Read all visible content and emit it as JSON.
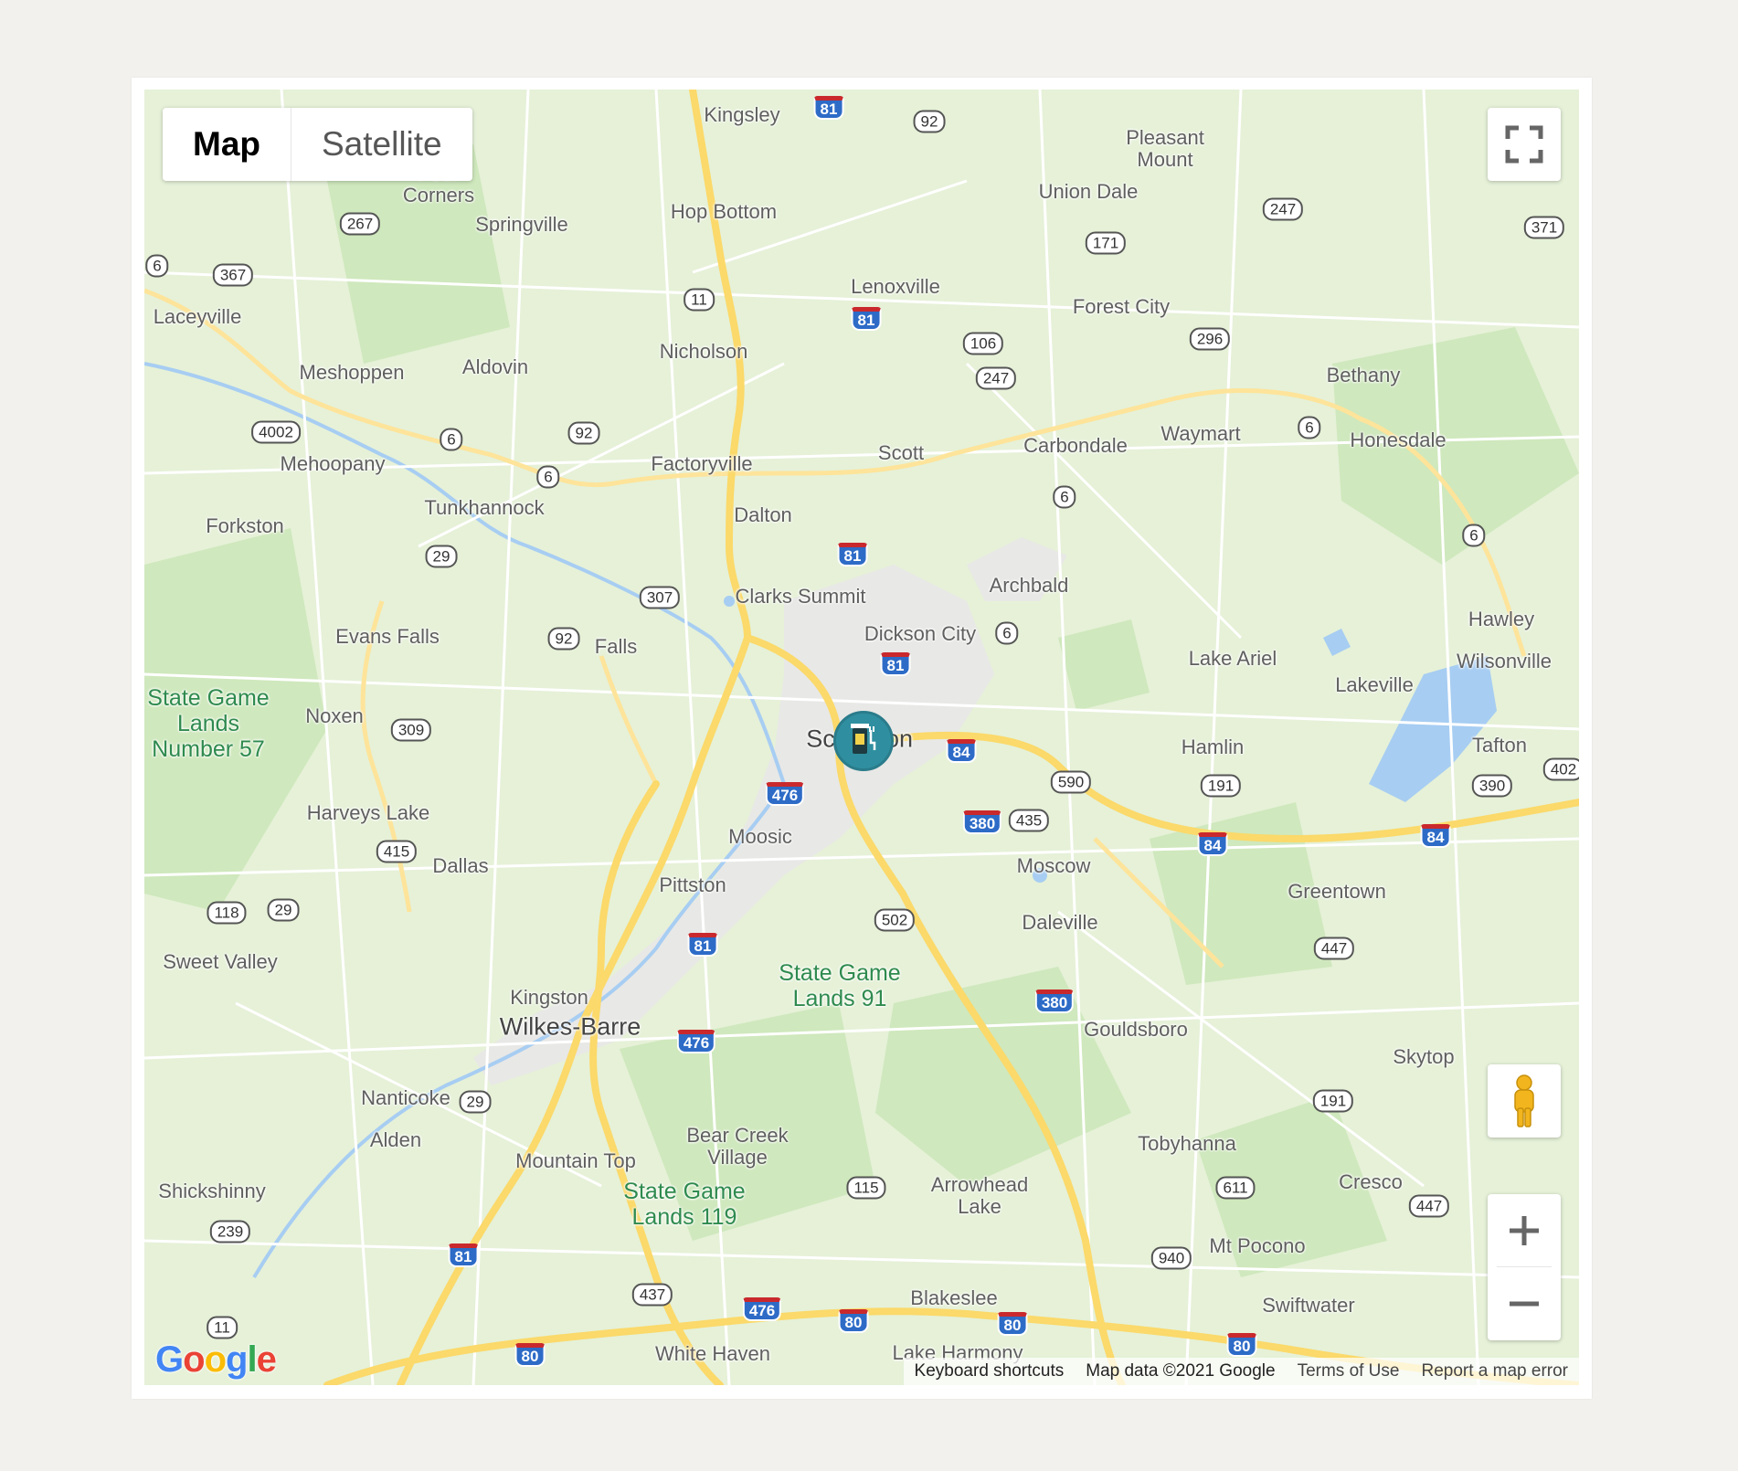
{
  "map_type_control": {
    "map_label": "Map",
    "satellite_label": "Satellite",
    "selected": "Map"
  },
  "controls": {
    "fullscreen_icon": "fullscreen-icon",
    "street_view_icon": "pegman-icon",
    "zoom_in_icon": "plus-icon",
    "zoom_out_icon": "minus-icon"
  },
  "marker": {
    "icon": "ev-charging-station-icon",
    "color": "#2f8fa0"
  },
  "footer": {
    "logo": "Google",
    "keyboard_shortcuts": "Keyboard shortcuts",
    "map_data": "Map data ©2021 Google",
    "terms": "Terms of Use",
    "report": "Report a map error"
  },
  "places": {
    "kingsley": "Kingsley",
    "pleasant_mount": "Pleasant\nMount",
    "union_dale": "Union Dale",
    "four_corners": "Four\nCorners",
    "springville": "Springville",
    "hop_bottom": "Hop Bottom",
    "laceyville": "Laceyville",
    "lenoxville": "Lenoxville",
    "forest_city": "Forest City",
    "meshoppen": "Meshoppen",
    "aldovin": "Aldovin",
    "nicholson": "Nicholson",
    "bethany": "Bethany",
    "mehoopany": "Mehoopany",
    "factoryville": "Factoryville",
    "scott": "Scott",
    "carbondale": "Carbondale",
    "waymart": "Waymart",
    "honesdale": "Honesdale",
    "forkston": "Forkston",
    "tunkhannock": "Tunkhannock",
    "dalton": "Dalton",
    "archbald": "Archbald",
    "clarks_summit": "Clarks Summit",
    "hawley": "Hawley",
    "evans_falls": "Evans Falls",
    "falls": "Falls",
    "dickson_city": "Dickson City",
    "lake_ariel": "Lake Ariel",
    "wilsonville": "Wilsonville",
    "lakeville": "Lakeville",
    "noxen": "Noxen",
    "scranton_left": "Sc",
    "scranton_right": "on",
    "hamlin": "Hamlin",
    "tafton": "Tafton",
    "harveys_lake": "Harveys Lake",
    "moosic": "Moosic",
    "moscow": "Moscow",
    "dallas": "Dallas",
    "pittston": "Pittston",
    "greentown": "Greentown",
    "daleville": "Daleville",
    "sweet_valley": "Sweet Valley",
    "kingston": "Kingston",
    "wilkes_barre": "Wilkes-Barre",
    "gouldsboro": "Gouldsboro",
    "skytop": "Skytop",
    "nanticoke": "Nanticoke",
    "alden": "Alden",
    "bear_creek": "Bear Creek\nVillage",
    "tobyhanna": "Tobyhanna",
    "mountain_top": "Mountain Top",
    "arrowhead_lake": "Arrowhead\nLake",
    "cresco": "Cresco",
    "shickshinny": "Shickshinny",
    "mt_pocono": "Mt Pocono",
    "swiftwater": "Swiftwater",
    "blakeslee": "Blakeslee",
    "white_haven": "White Haven",
    "lake_harmony": "Lake Harmony"
  },
  "parks": {
    "sgl57": "State Game\nLands\nNumber 57",
    "sgl91": "State Game\nLands 91",
    "sgl119": "State Game\nLands 119"
  },
  "routes": {
    "r81a": "81",
    "r92a": "92",
    "r267": "267",
    "r247a": "247",
    "r371": "371",
    "r6a": "6",
    "r367": "367",
    "r171": "171",
    "r11a": "11",
    "r81b": "81",
    "r106": "106",
    "r296": "296",
    "r247b": "247",
    "r4002": "4002",
    "r92b": "92",
    "r6b": "6",
    "r6c": "6",
    "r6d": "6",
    "r6e": "6",
    "r6f": "6",
    "r29a": "29",
    "r81c": "81",
    "r307": "307",
    "r92c": "92",
    "r6g": "6",
    "r81d": "81",
    "r309": "309",
    "r84a": "84",
    "r590": "590",
    "r476a": "476",
    "r435": "435",
    "r380a": "380",
    "r191a": "191",
    "r390": "390",
    "r402": "402",
    "r84b": "84",
    "r84c": "84",
    "r415": "415",
    "r118": "118",
    "r29b": "29",
    "r502": "502",
    "r81e": "81",
    "r447a": "447",
    "r380b": "380",
    "r476b": "476",
    "r29c": "29",
    "r191b": "191",
    "r115": "115",
    "r611": "611",
    "r447b": "447",
    "r239": "239",
    "r81f": "81",
    "r940": "940",
    "r437": "437",
    "r11b": "11",
    "r476c": "476",
    "r80a": "80",
    "r80b": "80",
    "r80c": "80",
    "r80d": "80"
  },
  "colors": {
    "land": "#e6f1d8",
    "forest": "#c8e4b4",
    "urban": "#e8e8e6",
    "highway": "#fbd96a",
    "water": "#a7cdf2"
  }
}
